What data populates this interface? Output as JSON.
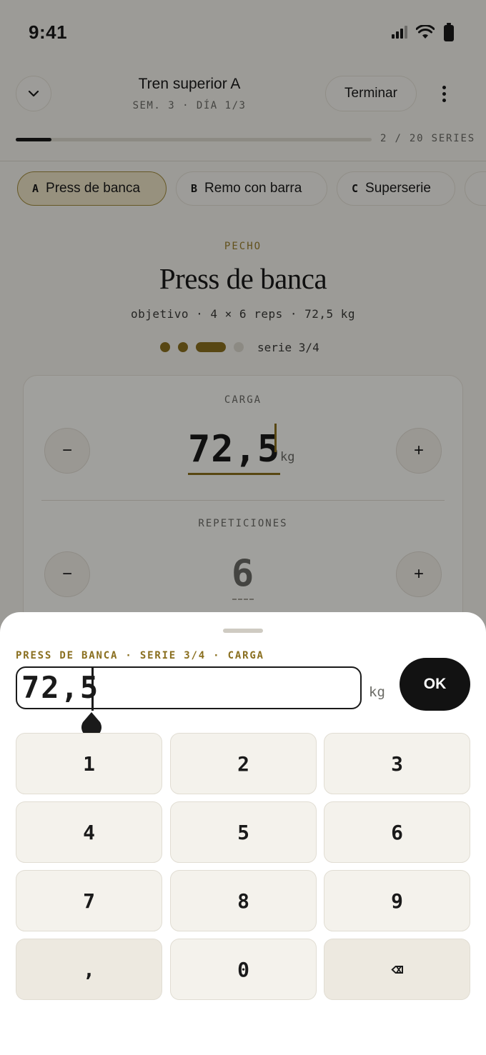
{
  "status_bar": {
    "time": "9:41"
  },
  "header": {
    "title": "Tren superior A",
    "subtitle": "SEM. 3 · DÍA 1/3",
    "finish_label": "Terminar",
    "progress": {
      "label": "2 / 20 SERIES",
      "completed": 2,
      "total": 20
    }
  },
  "exercise_tabs": [
    {
      "letter": "A",
      "label": "Press de banca",
      "active": true
    },
    {
      "letter": "B",
      "label": "Remo con barra",
      "active": false
    },
    {
      "letter": "C",
      "label": "Superserie",
      "active": false
    }
  ],
  "exercise": {
    "muscle": "PECHO",
    "name": "Press de banca",
    "objective": "objetivo · 4 × 6 reps · 72,5 kg",
    "set_label": "serie 3/4",
    "sets_total": 4,
    "current_set": 3
  },
  "card": {
    "load_label": "CARGA",
    "load_value": "72,5",
    "load_unit": "kg",
    "reps_label": "REPETICIONES",
    "reps_value": "6",
    "minus": "−",
    "plus": "+"
  },
  "sheet": {
    "context": "PRESS DE BANCA · SERIE 3/4 · CARGA",
    "input_value": "72,5",
    "unit": "kg",
    "ok_label": "OK",
    "keys": [
      "1",
      "2",
      "3",
      "4",
      "5",
      "6",
      "7",
      "8",
      "9",
      ",",
      "0",
      "⌫"
    ]
  },
  "colors": {
    "accent": "#8a6f1f",
    "chip_active_bg": "#ede3c5",
    "background": "#f4f2ec",
    "ok_button": "#121212"
  }
}
